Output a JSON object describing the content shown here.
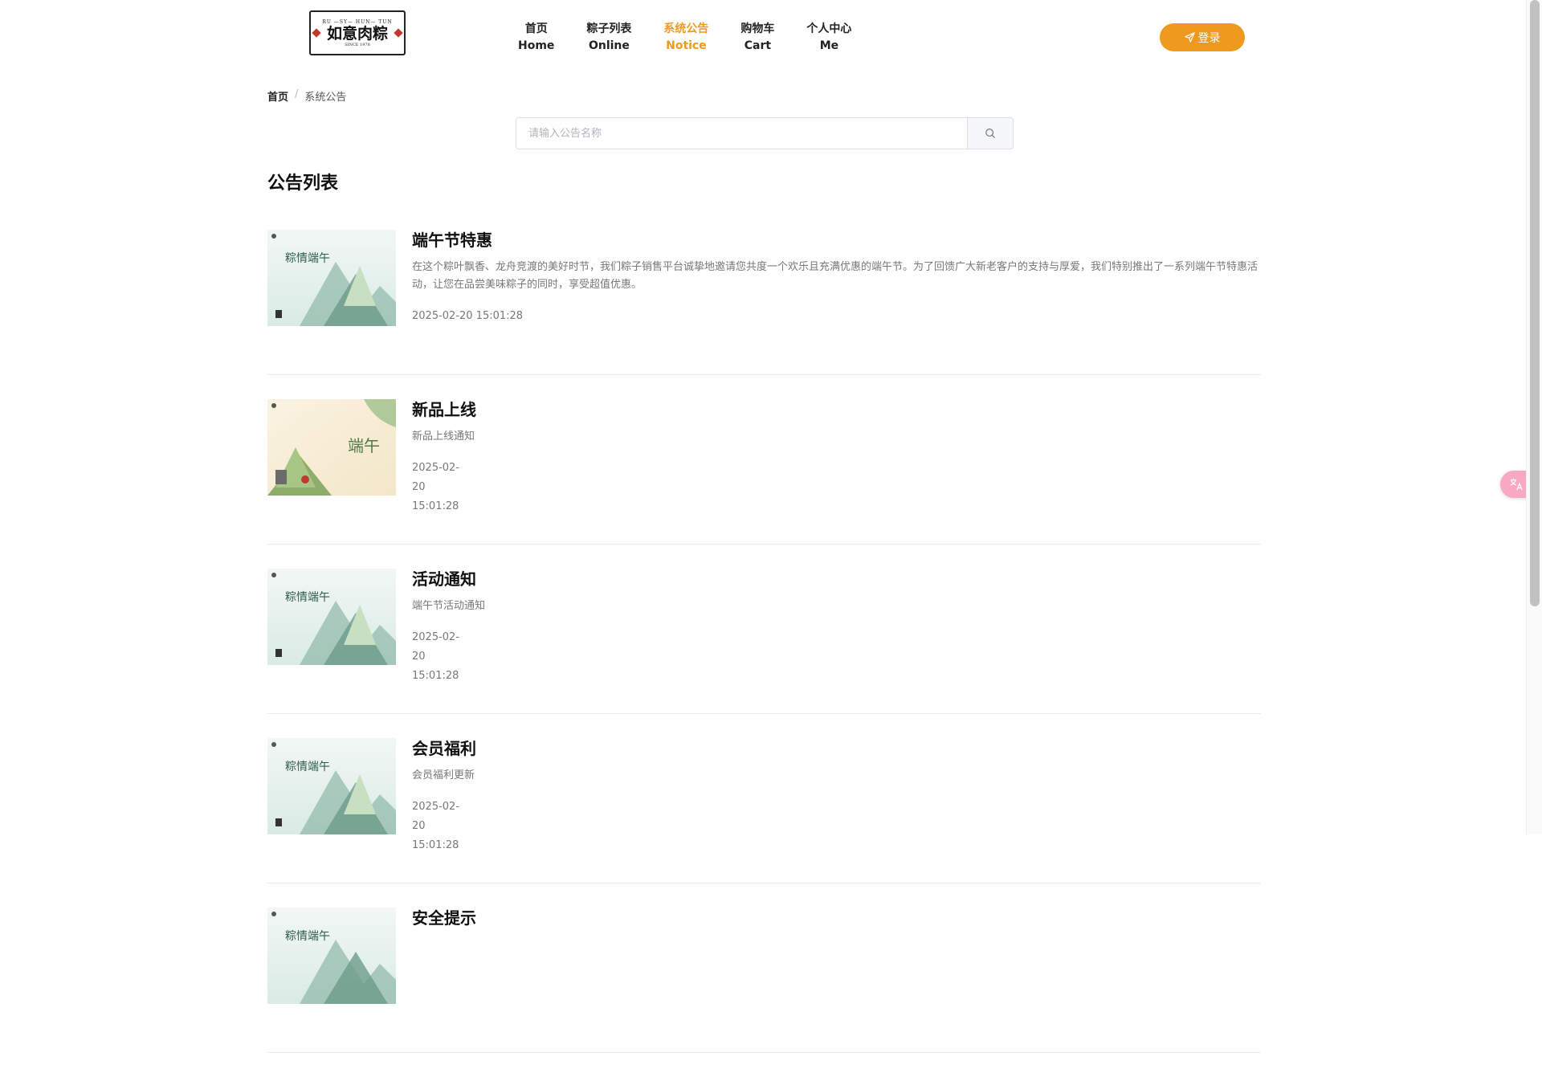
{
  "header": {
    "logo": {
      "top_text": "RU —SY— HUN— TUN",
      "name": "如意肉粽",
      "since": "SINCE 1978"
    },
    "nav": [
      {
        "zh": "首页",
        "en": "Home",
        "active": false
      },
      {
        "zh": "粽子列表",
        "en": "Online",
        "active": false
      },
      {
        "zh": "系统公告",
        "en": "Notice",
        "active": true
      },
      {
        "zh": "购物车",
        "en": "Cart",
        "active": false
      },
      {
        "zh": "个人中心",
        "en": "Me",
        "active": false
      }
    ],
    "login_label": "登录",
    "accent_color": "#ee9a1e"
  },
  "breadcrumb": {
    "home": "首页",
    "separator": "/",
    "current": "系统公告"
  },
  "search": {
    "placeholder": "请输入公告名称",
    "value": ""
  },
  "section_title": "公告列表",
  "notices": [
    {
      "title": "端午节特惠",
      "desc": "在这个粽叶飘香、龙舟竞渡的美好时节，我们粽子销售平台诚挚地邀请您共度一个欢乐且充满优惠的端午节。为了回馈广大新老客户的支持与厚爱，我们特别推出了一系列端午节特惠活动，让您在品尝美味粽子的同时，享受超值优惠。",
      "time": "2025-02-20 15:01:28",
      "thumb": "a",
      "thumb_title": "粽情端午"
    },
    {
      "title": "新品上线",
      "desc": "新品上线通知",
      "time": "2025-02-20 15:01:28",
      "thumb": "b",
      "thumb_title": "端午"
    },
    {
      "title": "活动通知",
      "desc": "端午节活动通知",
      "time": "2025-02-20 15:01:28",
      "thumb": "a",
      "thumb_title": "粽情端午"
    },
    {
      "title": "会员福利",
      "desc": "会员福利更新",
      "time": "2025-02-20 15:01:28",
      "thumb": "a",
      "thumb_title": "粽情端午"
    },
    {
      "title": "安全提示",
      "desc": "",
      "time": "",
      "thumb": "a",
      "thumb_title": "粽情端午"
    }
  ],
  "icons": {
    "login": "send-icon",
    "search": "search-icon",
    "translate": "translate-icon"
  }
}
